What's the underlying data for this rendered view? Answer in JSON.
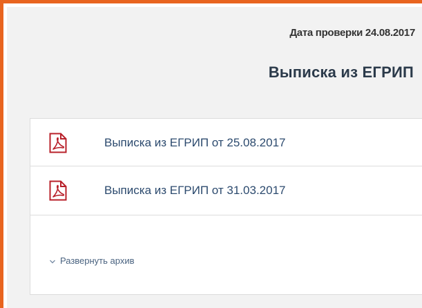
{
  "header": {
    "check_date": "Дата проверки 24.08.2017",
    "title": "Выписка из ЕГРИП"
  },
  "documents": [
    {
      "label": "Выписка из ЕГРИП от 25.08.2017",
      "icon": "pdf-icon"
    },
    {
      "label": "Выписка из ЕГРИП от 31.03.2017",
      "icon": "pdf-icon"
    }
  ],
  "archive": {
    "label": "Развернуть архив",
    "icon": "chevron-down-icon"
  },
  "colors": {
    "frame_border": "#e8641f",
    "panel_background": "#f2f2f2",
    "pdf_red": "#b8202a",
    "link_blue": "#2c4a6e"
  }
}
